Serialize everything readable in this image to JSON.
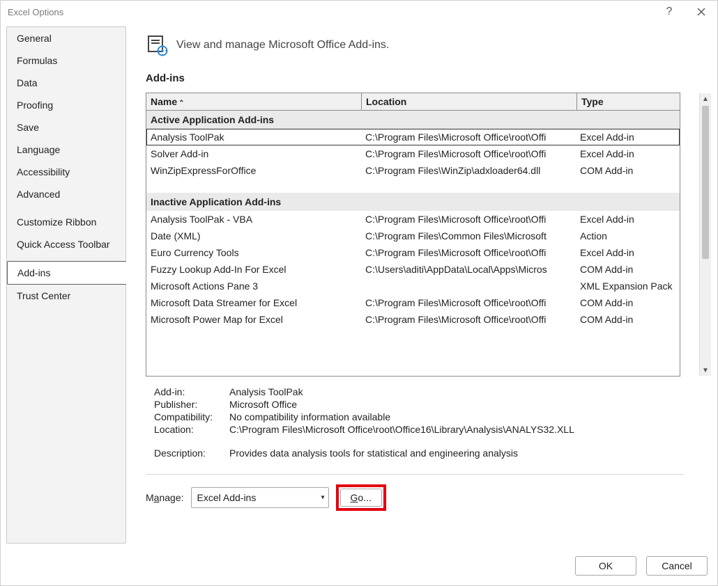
{
  "window": {
    "title": "Excel Options"
  },
  "sidebar": {
    "items": [
      {
        "label": "General",
        "selected": false,
        "gap": false
      },
      {
        "label": "Formulas",
        "selected": false,
        "gap": false
      },
      {
        "label": "Data",
        "selected": false,
        "gap": false
      },
      {
        "label": "Proofing",
        "selected": false,
        "gap": false
      },
      {
        "label": "Save",
        "selected": false,
        "gap": false
      },
      {
        "label": "Language",
        "selected": false,
        "gap": false
      },
      {
        "label": "Accessibility",
        "selected": false,
        "gap": false
      },
      {
        "label": "Advanced",
        "selected": false,
        "gap": false
      },
      {
        "label": "Customize Ribbon",
        "selected": false,
        "gap": true
      },
      {
        "label": "Quick Access Toolbar",
        "selected": false,
        "gap": false
      },
      {
        "label": "Add-ins",
        "selected": true,
        "gap": true
      },
      {
        "label": "Trust Center",
        "selected": false,
        "gap": false
      }
    ]
  },
  "header": {
    "text": "View and manage Microsoft Office Add-ins."
  },
  "section": {
    "title": "Add-ins"
  },
  "table": {
    "cols": {
      "name": "Name",
      "location": "Location",
      "type": "Type"
    },
    "groups": [
      {
        "title": "Active Application Add-ins",
        "rows": [
          {
            "name": "Analysis ToolPak",
            "location": "C:\\Program Files\\Microsoft Office\\root\\Offi",
            "type": "Excel Add-in",
            "selected": true
          },
          {
            "name": "Solver Add-in",
            "location": "C:\\Program Files\\Microsoft Office\\root\\Offi",
            "type": "Excel Add-in"
          },
          {
            "name": "WinZipExpressForOffice",
            "location": "C:\\Program Files\\WinZip\\adxloader64.dll",
            "type": "COM Add-in"
          }
        ]
      },
      {
        "title": "Inactive Application Add-ins",
        "rows": [
          {
            "name": "Analysis ToolPak - VBA",
            "location": "C:\\Program Files\\Microsoft Office\\root\\Offi",
            "type": "Excel Add-in"
          },
          {
            "name": "Date (XML)",
            "location": "C:\\Program Files\\Common Files\\Microsoft",
            "type": "Action"
          },
          {
            "name": "Euro Currency Tools",
            "location": "C:\\Program Files\\Microsoft Office\\root\\Offi",
            "type": "Excel Add-in"
          },
          {
            "name": "Fuzzy Lookup Add-In For Excel",
            "location": "C:\\Users\\aditi\\AppData\\Local\\Apps\\Micros",
            "type": "COM Add-in"
          },
          {
            "name": "Microsoft Actions Pane 3",
            "location": "",
            "type": "XML Expansion Pack"
          },
          {
            "name": "Microsoft Data Streamer for Excel",
            "location": "C:\\Program Files\\Microsoft Office\\root\\Offi",
            "type": "COM Add-in"
          },
          {
            "name": "Microsoft Power Map for Excel",
            "location": "C:\\Program Files\\Microsoft Office\\root\\Offi",
            "type": "COM Add-in"
          }
        ]
      }
    ]
  },
  "details": {
    "addin_label": "Add-in:",
    "addin": "Analysis ToolPak",
    "publisher_label": "Publisher:",
    "publisher": "Microsoft Office",
    "compat_label": "Compatibility:",
    "compat": "No compatibility information available",
    "location_label": "Location:",
    "location": "C:\\Program Files\\Microsoft Office\\root\\Office16\\Library\\Analysis\\ANALYS32.XLL",
    "desc_label": "Description:",
    "desc": "Provides data analysis tools for statistical and engineering analysis"
  },
  "manage": {
    "label": "Manage:",
    "selected": "Excel Add-ins",
    "go": "Go..."
  },
  "footer": {
    "ok": "OK",
    "cancel": "Cancel"
  }
}
